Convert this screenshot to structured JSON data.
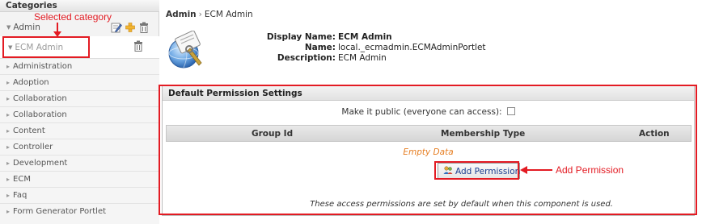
{
  "sidebar": {
    "title": "Categories",
    "admin_label": "Admin",
    "selected_label": "ECM Admin",
    "items": [
      {
        "label": "Administration"
      },
      {
        "label": "Adoption"
      },
      {
        "label": "Collaboration"
      },
      {
        "label": "Collaboration"
      },
      {
        "label": "Content"
      },
      {
        "label": "Controller"
      },
      {
        "label": "Development"
      },
      {
        "label": "ECM"
      },
      {
        "label": "Faq"
      },
      {
        "label": "Form Generator Portlet"
      }
    ],
    "icons": [
      "edit-icon",
      "add-icon",
      "trash-icon"
    ]
  },
  "annotations": {
    "selected_category": "Selected category",
    "add_permission": "Add Permission"
  },
  "breadcrumb": {
    "root": "Admin",
    "separator": "›",
    "current": "ECM Admin"
  },
  "portlet": {
    "display_name_key": "Display Name:",
    "display_name": "ECM Admin",
    "name_key": "Name:",
    "name": "local._ecmadmin.ECMAdminPortlet",
    "description_key": "Description:",
    "description": "ECM Admin"
  },
  "permissions": {
    "title": "Default Permission Settings",
    "public_label": "Make it public (everyone can access):",
    "public_checked": false,
    "columns": [
      "Group Id",
      "Membership Type",
      "Action"
    ],
    "empty_text": "Empty Data",
    "add_button": "Add Permission",
    "note": "These access permissions are set by default when this component is used."
  },
  "colors": {
    "annotation": "#e31b23",
    "empty_text": "#e67e22",
    "link": "#1a3d8f"
  }
}
